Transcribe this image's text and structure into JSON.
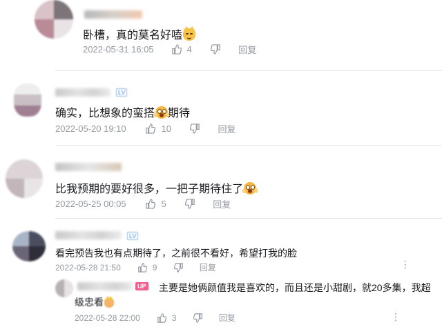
{
  "comments": [
    {
      "text": "卧槽，真的莫名好嗑",
      "date": "2022-05-31 16:05",
      "likes": "4",
      "reply_label": "回复",
      "emoji": "cat-face-icon"
    },
    {
      "text": "确实，比想象的蛮搭",
      "text_suffix": "期待",
      "date": "2022-05-20 19:10",
      "likes": "10",
      "reply_label": "回复",
      "emoji": "shocked-face-icon"
    },
    {
      "text": "比我预期的要好很多，一把子期待住了",
      "date": "2022-05-25 00:05",
      "likes": "5",
      "reply_label": "回复",
      "emoji": "shocked-face-icon"
    },
    {
      "text": "看完预告我也有点期待了，之前很不看好，希望打我的脸",
      "date": "2022-05-28 21:50",
      "likes": "9",
      "reply_label": "回复"
    }
  ],
  "reply": {
    "badge": "UP",
    "text_line1": "主要是她俩颜值我是喜欢的，而且还是小甜剧，就20多集，我超",
    "text_line2": "级忠看",
    "date": "2022-05-28 22:00",
    "likes": "3",
    "reply_label": "回复"
  },
  "colors": {
    "meta": "#9499a0",
    "text": "#18191c",
    "up_badge": "#f25d8e",
    "divider": "#e3e5e7"
  }
}
